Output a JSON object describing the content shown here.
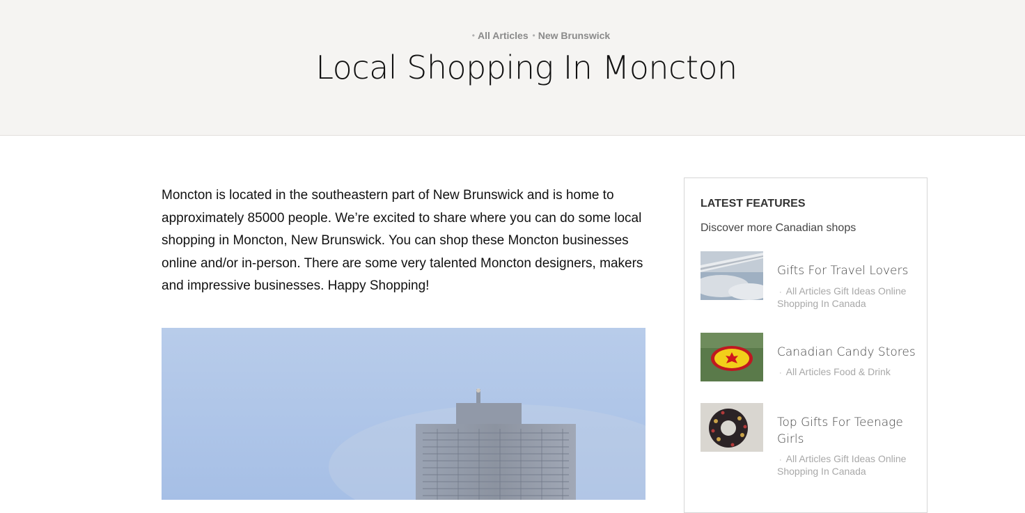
{
  "breadcrumb": {
    "items": [
      "All Articles",
      "New Brunswick"
    ]
  },
  "page_title": "Local Shopping In Moncton",
  "intro_text": "Moncton is located in the southeastern part of New Brunswick and is home to approximately 85000 people. We’re excited to share where you can do some local shopping in Moncton, New Brunswick. You can shop these Moncton businesses online and/or in-person. There are some very talented Moncton designers, makers and impressive businesses. Happy Shopping!",
  "sidebar": {
    "heading": "LATEST FEATURES",
    "subheading": "Discover more Canadian shops",
    "features": [
      {
        "title": "Gifts For Travel Lovers",
        "meta": "All Articles Gift Ideas Online Shopping In Canada",
        "image": "airplane-wing-photo"
      },
      {
        "title": "Canadian Candy Stores",
        "meta": "All Articles Food & Drink",
        "image": "maple-candy-photo"
      },
      {
        "title": "Top Gifts For Teenage Girls",
        "meta": "All Articles Gift Ideas Online Shopping In Canada",
        "image": "scrunchie-photo"
      }
    ]
  },
  "colors": {
    "hero_bg": "#f5f4f2",
    "meta_grey": "#a8a8a8",
    "crumb_grey": "#8a8a8a"
  }
}
